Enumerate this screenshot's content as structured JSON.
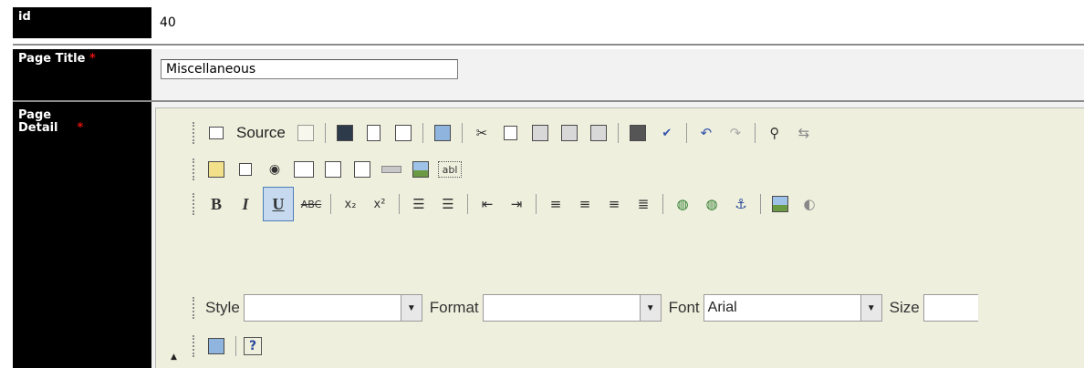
{
  "rows": {
    "id": {
      "label": "id",
      "value": "40"
    },
    "title": {
      "label": "Page Title",
      "required": "*",
      "value": "Miscellaneous"
    },
    "detail": {
      "label": "Page Detail",
      "required": "*"
    }
  },
  "editor": {
    "toolbar1": {
      "source_label": "Source"
    },
    "toolbar3": {
      "bold": "B",
      "italic": "I",
      "underline": "U",
      "strike": "ABC",
      "subscript": "x₂",
      "superscript": "x²"
    },
    "combos": {
      "style_label": "Style",
      "style_value": "",
      "format_label": "Format",
      "format_value": "",
      "font_label": "Font",
      "font_value": "Arial",
      "size_label": "Size",
      "size_value": ""
    },
    "textfield_icon_text": "abl"
  },
  "colors": {
    "label_bg": "#000000",
    "required": "#e01010",
    "editor_bg": "#efefde",
    "active": "#c6d9ee",
    "overlay_arrow": "#f39c55"
  }
}
